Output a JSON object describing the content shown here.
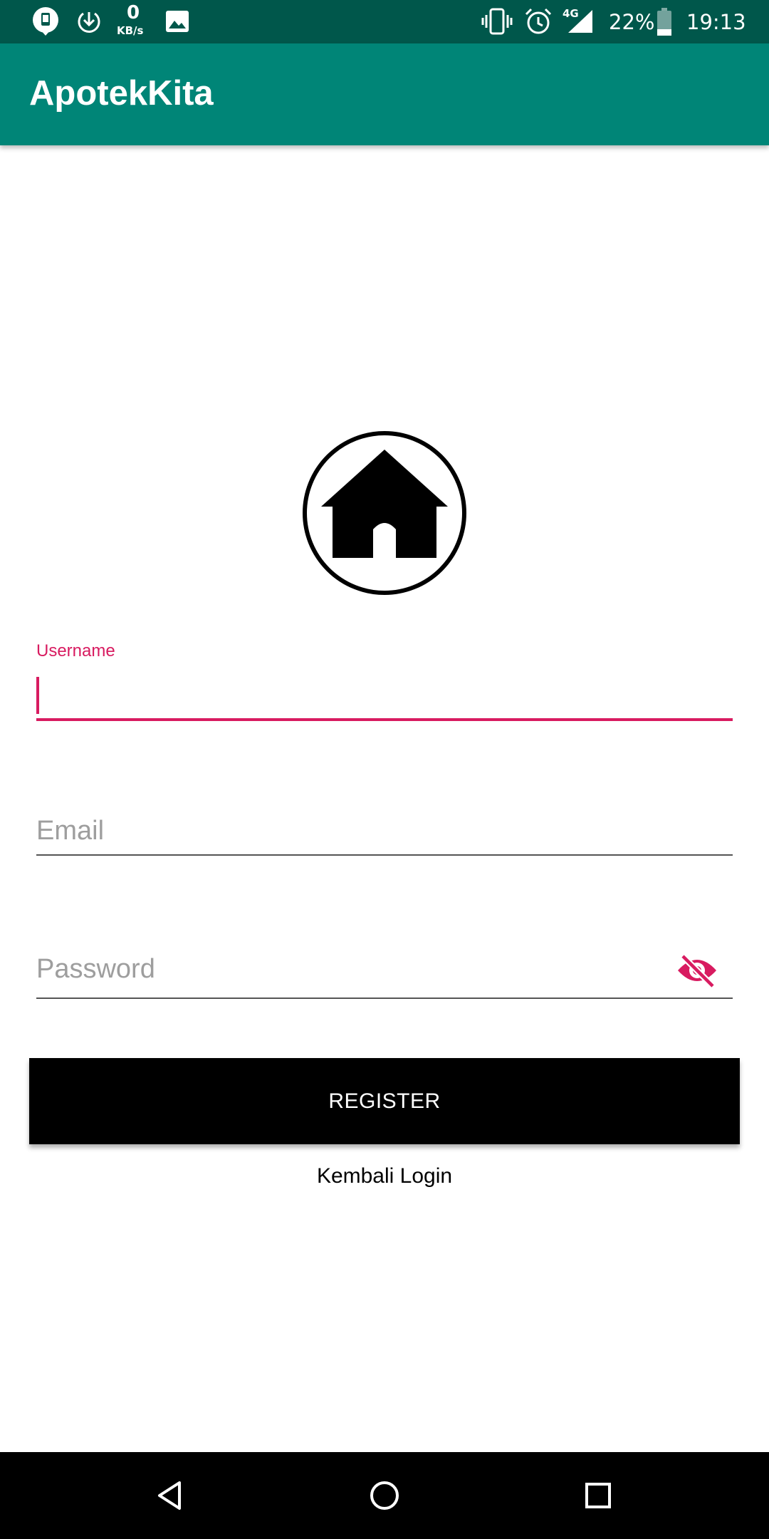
{
  "status_bar": {
    "net_speed_value": "0",
    "net_speed_unit": "KB/s",
    "network_type": "4G",
    "battery_percent": "22%",
    "time": "19:13",
    "icons": [
      "notification-app-icon",
      "download-icon",
      "image-icon",
      "vibrate-icon",
      "alarm-icon",
      "signal-icon",
      "battery-icon"
    ]
  },
  "app_bar": {
    "title": "ApotekKita"
  },
  "logo": {
    "icon": "home-icon"
  },
  "form": {
    "username": {
      "label": "Username",
      "value": "",
      "placeholder": ""
    },
    "email": {
      "label": "Email",
      "value": "",
      "placeholder": "Email"
    },
    "password": {
      "label": "Password",
      "value": "",
      "placeholder": "Password",
      "toggle_icon": "eye-off-icon"
    },
    "register_label": "REGISTER",
    "back_login_label": "Kembali Login"
  },
  "nav_bar": {
    "buttons": [
      "back-icon",
      "home-circle-icon",
      "recents-icon"
    ]
  },
  "colors": {
    "status_bar": "#00574B",
    "app_bar": "#008577",
    "accent": "#D81B60",
    "button": "#000000"
  }
}
